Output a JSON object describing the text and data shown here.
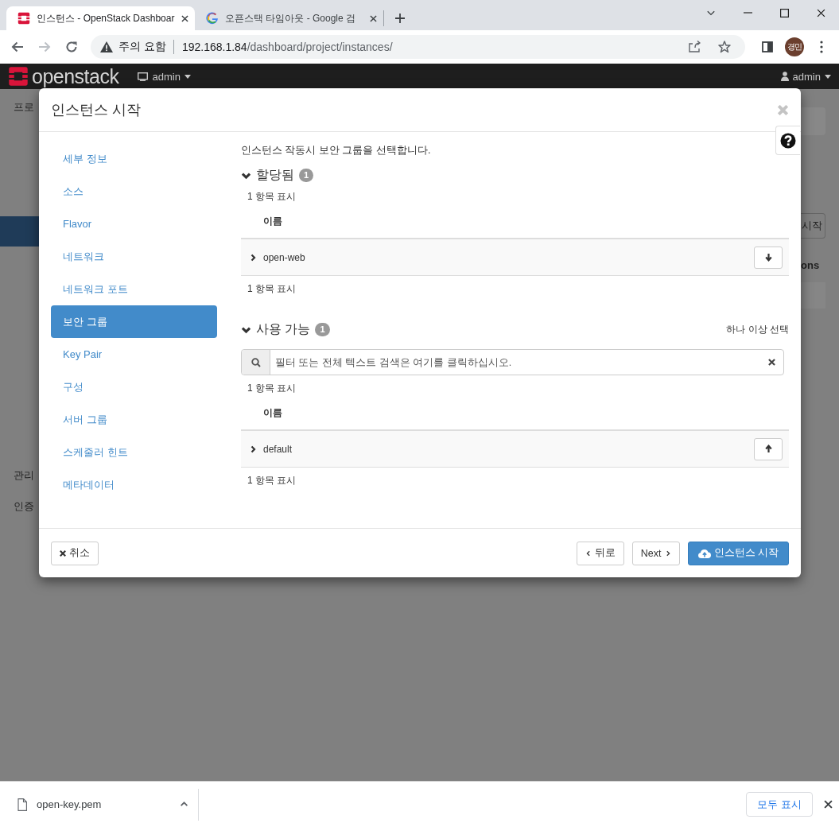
{
  "browser": {
    "tabs": [
      {
        "title": "인스턴스 - OpenStack Dashboar",
        "selected": true
      },
      {
        "title": "오픈스택 타임아웃 - Google 검",
        "selected": false
      }
    ],
    "forward": {
      "disabled": true
    },
    "address": {
      "security": "주의 요함",
      "host": "192.168.1.84",
      "path": "/dashboard/project/instances/"
    },
    "profile": "경민"
  },
  "background": {
    "logo": "openstack",
    "project_menu": "admin",
    "user_menu": "admin",
    "sidebar": [
      "프로",
      "관리",
      "인증"
    ],
    "button": "시작",
    "column": "ons"
  },
  "modal": {
    "title": "인스턴스 시작",
    "steps": [
      {
        "label": "세부 정보",
        "selected": false
      },
      {
        "label": "소스",
        "selected": false
      },
      {
        "label": "Flavor",
        "selected": false
      },
      {
        "label": "네트워크",
        "selected": false
      },
      {
        "label": "네트워크 포트",
        "selected": false
      },
      {
        "label": "보안 그룹",
        "selected": true
      },
      {
        "label": "Key Pair",
        "selected": false
      },
      {
        "label": "구성",
        "selected": false
      },
      {
        "label": "서버 그룹",
        "selected": false
      },
      {
        "label": "스케줄러 힌트",
        "selected": false
      },
      {
        "label": "메타데이터",
        "selected": false
      }
    ],
    "description": "인스턴스 작동시 보안 그룹을 선택합니다.",
    "sections": [
      {
        "kind": "allocated",
        "title": "할당됨",
        "count": "1",
        "expanded": true,
        "summary_top": "1 항목 표시",
        "column": "이름",
        "rows": [
          {
            "name": "open-web",
            "expanded": false
          }
        ],
        "summary_bottom": "1 항목 표시"
      },
      {
        "kind": "available",
        "title": "사용 가능",
        "count": "1",
        "expanded": true,
        "hint": "하나 이상 선택",
        "search": {
          "placeholder": "필터 또는 전체 텍스트 검색은 여기를 클릭하십시오."
        },
        "summary_top": "1 항목 표시",
        "column": "이름",
        "rows": [
          {
            "name": "default",
            "expanded": false
          }
        ],
        "summary_bottom": "1 항목 표시"
      }
    ],
    "footer": {
      "cancel": "취소",
      "back": "뒤로",
      "next": "Next",
      "launch": "인스턴스 시작"
    }
  },
  "downloads": {
    "file": "open-key.pem",
    "show_all": "모두 표시"
  }
}
